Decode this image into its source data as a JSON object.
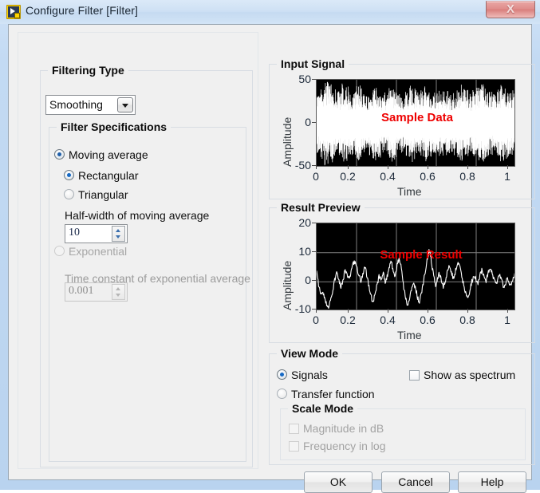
{
  "window": {
    "title": "Configure Filter [Filter]",
    "icon": "labview-filter-icon",
    "close_label": "X"
  },
  "left_panel": {
    "filtering_type": {
      "legend": "Filtering Type",
      "combo_value": "Smoothing"
    },
    "filter_specifications": {
      "legend": "Filter Specifications",
      "moving_average": "Moving average",
      "rectangular": "Rectangular",
      "triangular": "Triangular",
      "halfwidth_label": "Half-width of moving average",
      "halfwidth_value": "10",
      "exponential": "Exponential",
      "timeconstant_label": "Time constant of exponential average",
      "timeconstant_value": "0.001"
    }
  },
  "input_signal": {
    "legend": "Input Signal",
    "watermark": "Sample Data"
  },
  "result_preview": {
    "legend": "Result Preview",
    "watermark": "Sample Result"
  },
  "view_mode": {
    "legend": "View Mode",
    "signals": "Signals",
    "transfer_function": "Transfer function",
    "show_as_spectrum": "Show as spectrum",
    "scale_mode": {
      "legend": "Scale Mode",
      "magnitude_db": "Magnitude in dB",
      "frequency_log": "Frequency in log"
    }
  },
  "buttons": {
    "ok": "OK",
    "cancel": "Cancel",
    "help": "Help"
  },
  "colors": {
    "accent": "#1f5fa9",
    "watermark": "#ee0000",
    "plot_background": "#000000",
    "trace": "#ffffff",
    "gridline": "#808080"
  },
  "chart_data": [
    {
      "type": "line",
      "title": "Input Signal",
      "xlabel": "Time",
      "ylabel": "Amplitude",
      "xlim": [
        0,
        1
      ],
      "ylim": [
        -50,
        50
      ],
      "xticks": [
        "0",
        "0.2",
        "0.4",
        "0.6",
        "0.8",
        "1"
      ],
      "yticks": [
        "50",
        "0",
        "-50"
      ],
      "grid": true,
      "annotation": "Sample Data",
      "series": [
        {
          "name": "Sample Data",
          "description": "Dense white band-limited random noise, zero mean, peak envelope roughly +/-45",
          "envelope": [
            32,
            38,
            44,
            41,
            36,
            34,
            42,
            39,
            33,
            35,
            40,
            37,
            31,
            34,
            38,
            36,
            30,
            33,
            41,
            38,
            34,
            31,
            36,
            40,
            37,
            33,
            35,
            39,
            36,
            32,
            34,
            37,
            35,
            31,
            33,
            38,
            41,
            36,
            32,
            35,
            39,
            42,
            38,
            34,
            31,
            36,
            40,
            37,
            33,
            35
          ]
        }
      ]
    },
    {
      "type": "line",
      "title": "Result Preview",
      "xlabel": "Time",
      "ylabel": "Amplitude",
      "xlim": [
        0,
        1
      ],
      "ylim": [
        -10,
        20
      ],
      "xticks": [
        "0",
        "0.2",
        "0.4",
        "0.6",
        "0.8",
        "1"
      ],
      "yticks": [
        "20",
        "10",
        "0",
        "-10"
      ],
      "grid": true,
      "annotation": "Sample Result",
      "series": [
        {
          "name": "Sample Result",
          "description": "Smoothed (moving-average) trace of the input noise, oscillating mostly between -9 and +11",
          "values": [
            3,
            -1,
            -4,
            -3,
            -6,
            -8,
            -9,
            -6,
            -3,
            1,
            3,
            1,
            -2,
            0,
            4,
            3,
            1,
            3,
            6,
            7,
            5,
            2,
            0,
            3,
            5,
            2,
            -2,
            -5,
            -7,
            -4,
            -1,
            2,
            1,
            3,
            0,
            2,
            5,
            7,
            4,
            2,
            6,
            8,
            5,
            -1,
            -5,
            -8,
            -6,
            -3,
            0,
            -2,
            -5,
            -7,
            -4,
            0,
            4,
            8,
            11,
            7,
            2,
            -1,
            1,
            3,
            0,
            -2,
            1,
            4,
            6,
            3,
            1,
            4,
            7,
            5,
            2,
            -1,
            -4,
            -6,
            -3,
            0,
            2,
            1,
            -1,
            2,
            4,
            2,
            0,
            3,
            5,
            3,
            1,
            -1,
            1,
            2,
            0,
            -2,
            0,
            1,
            -1,
            0,
            2,
            3
          ]
        }
      ]
    }
  ]
}
